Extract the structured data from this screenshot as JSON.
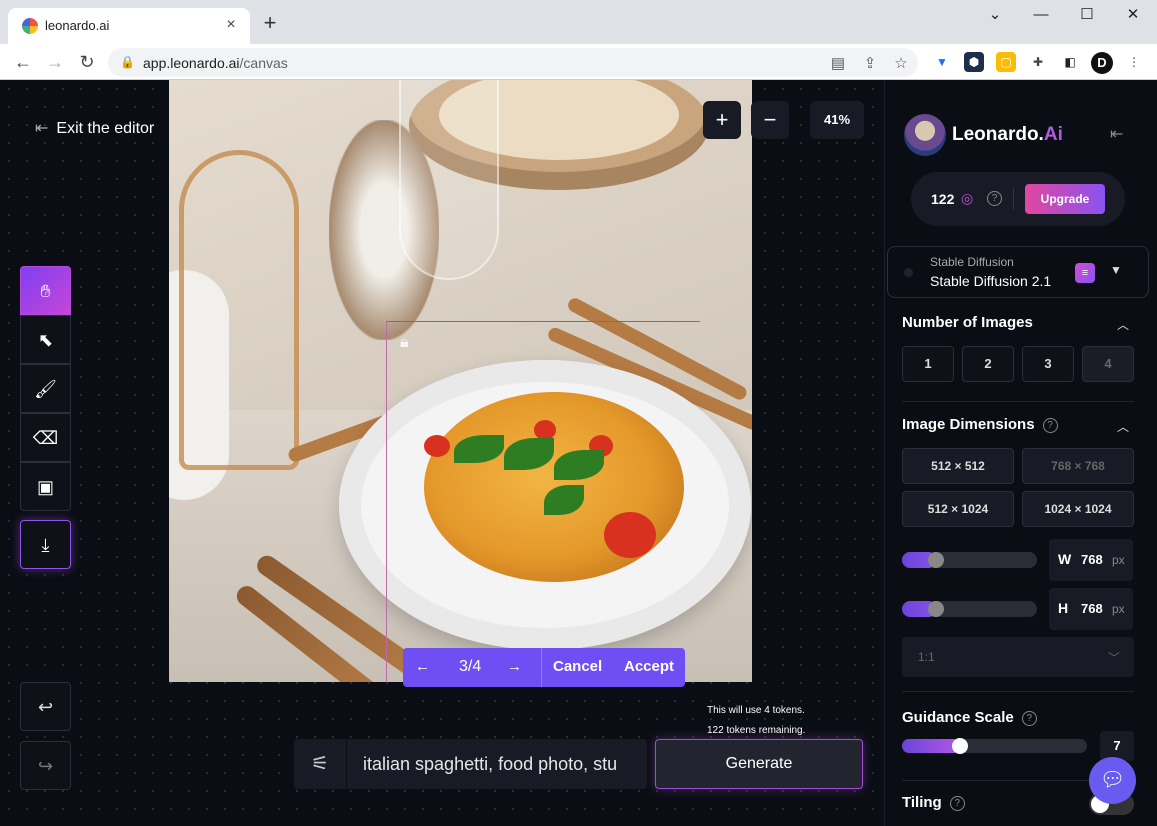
{
  "browser": {
    "tab_title": "leonardo.ai",
    "url_host": "app.leonardo.ai",
    "url_path": "/canvas",
    "profile_initial": "D"
  },
  "editor": {
    "exit_label": "Exit the editor",
    "zoom_in_label": "+",
    "zoom_out_label": "−",
    "zoom_value": "41%",
    "tools": [
      "hand-icon",
      "select-icon",
      "brush-icon",
      "eraser-icon",
      "image-icon",
      "download-icon"
    ],
    "variation_counter": "3/4",
    "cancel_label": "Cancel",
    "accept_label": "Accept",
    "token_use_text": "This will use 4 tokens.",
    "token_remaining_text": "122 tokens remaining.",
    "prompt_text": "italian spaghetti, food photo, stu",
    "generate_label": "Generate"
  },
  "panel": {
    "brand_name": "Leonardo.",
    "brand_suffix": "Ai",
    "credits": "122",
    "upgrade_label": "Upgrade",
    "model_subtitle": "Stable Diffusion",
    "model_name": "Stable Diffusion 2.1",
    "number_of_images_title": "Number of Images",
    "image_counts": [
      "1",
      "2",
      "3",
      "4"
    ],
    "image_dimensions_title": "Image Dimensions",
    "dimension_presets": [
      "512 × 512",
      "768 × 768",
      "512 × 1024",
      "1024 × 1024"
    ],
    "width_label": "W",
    "width_value": "768",
    "height_label": "H",
    "height_value": "768",
    "unit": "px",
    "aspect_ratio": "1:1",
    "guidance_title": "Guidance Scale",
    "guidance_value": "7",
    "tiling_title": "Tiling",
    "width_slider_level": 0.25,
    "height_slider_level": 0.25,
    "guidance_slider_level": 0.31
  },
  "colors": {
    "accent_purple": "#6f4ef3",
    "brand_pink": "#e147a0",
    "background": "#0b0d14"
  }
}
